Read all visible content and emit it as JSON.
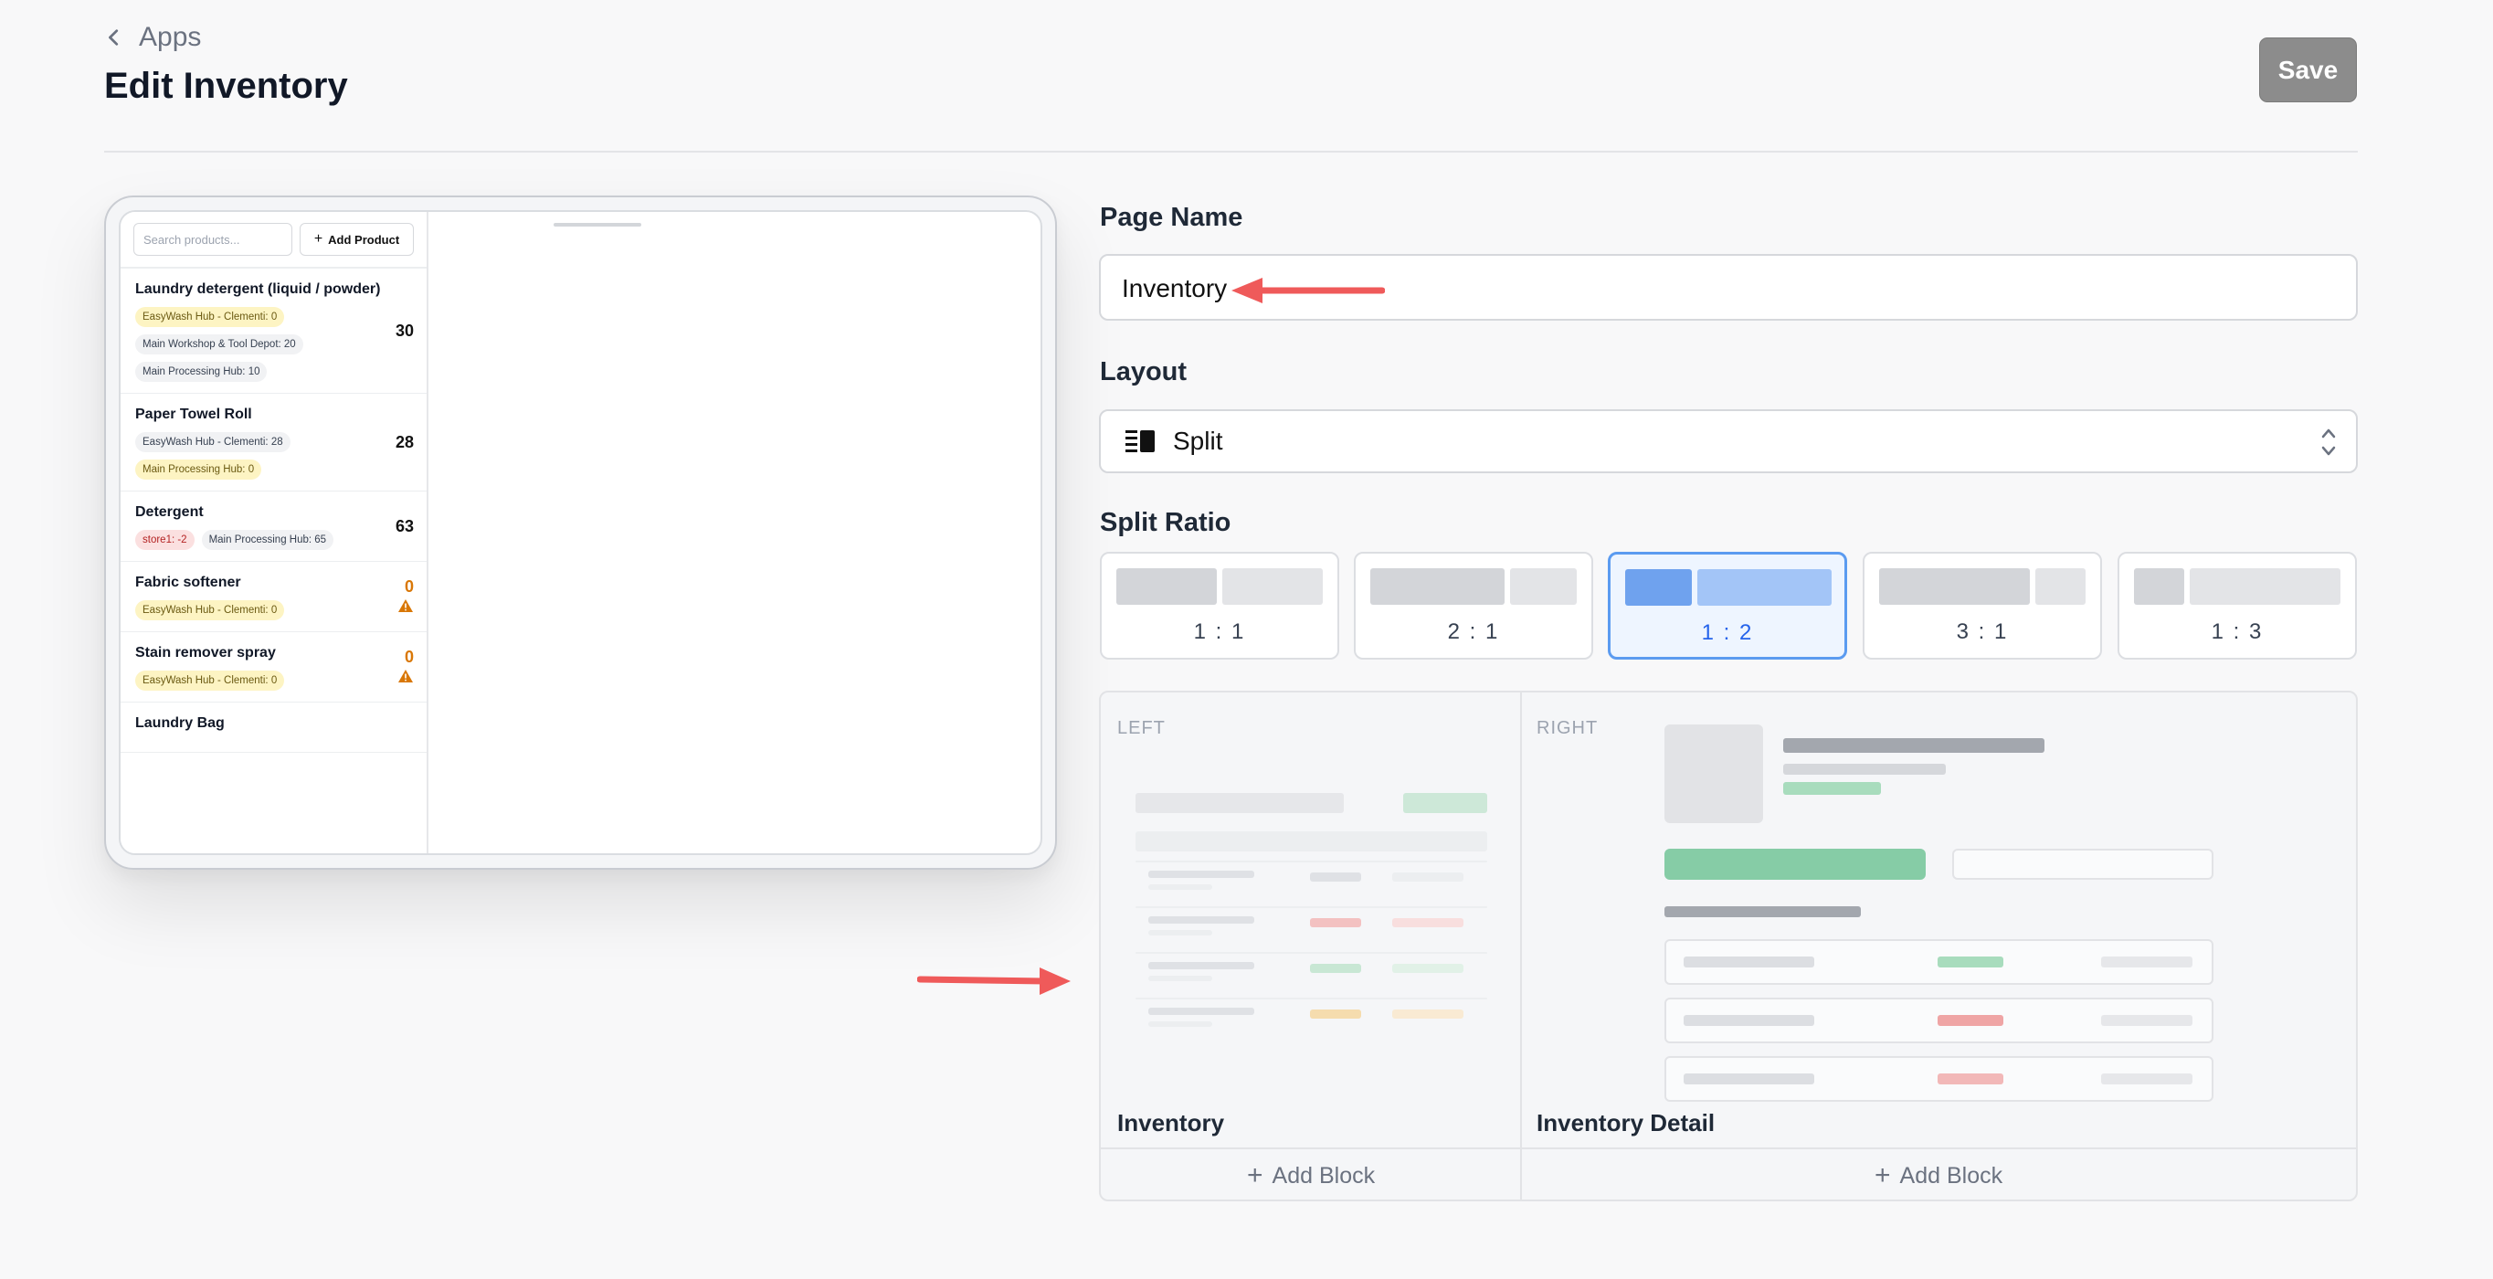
{
  "header": {
    "back_label": "Apps",
    "title": "Edit Inventory",
    "save_label": "Save"
  },
  "preview": {
    "search_placeholder": "Search products...",
    "add_product_label": "Add Product",
    "items": [
      {
        "name": "Laundry detergent (liquid / powder)",
        "qty": "30",
        "chips": [
          {
            "text": "EasyWash Hub - Clementi: 0",
            "tone": "yellow"
          },
          {
            "text": "Main Workshop & Tool Depot: 20",
            "tone": "gray"
          },
          {
            "text": "Main Processing Hub: 10",
            "tone": "gray"
          }
        ]
      },
      {
        "name": "Paper Towel Roll",
        "qty": "28",
        "chips": [
          {
            "text": "EasyWash Hub - Clementi: 28",
            "tone": "gray"
          },
          {
            "text": "Main Processing Hub: 0",
            "tone": "yellow"
          }
        ]
      },
      {
        "name": "Detergent",
        "qty": "63",
        "chips": [
          {
            "text": "store1: -2",
            "tone": "red"
          },
          {
            "text": "Main Processing Hub: 65",
            "tone": "gray"
          }
        ]
      },
      {
        "name": "Fabric softener",
        "qty": "0",
        "chips": [
          {
            "text": "EasyWash Hub - Clementi: 0",
            "tone": "yellow"
          }
        ]
      },
      {
        "name": "Stain remover spray",
        "qty": "0",
        "chips": [
          {
            "text": "EasyWash Hub - Clementi: 0",
            "tone": "yellow"
          }
        ]
      },
      {
        "name": "Laundry Bag",
        "qty": "",
        "chips": []
      }
    ]
  },
  "form": {
    "page_name_label": "Page Name",
    "page_name_value": "Inventory",
    "layout_label": "Layout",
    "layout_value": "Split",
    "split_ratio_label": "Split Ratio",
    "ratios": [
      {
        "label": "1 : 1",
        "selected": false
      },
      {
        "label": "2 : 1",
        "selected": false
      },
      {
        "label": "1 : 2",
        "selected": true
      },
      {
        "label": "3 : 1",
        "selected": false
      },
      {
        "label": "1 : 3",
        "selected": false
      }
    ]
  },
  "canvas": {
    "left_tag": "LEFT",
    "right_tag": "RIGHT",
    "left_name": "Inventory",
    "right_name": "Inventory Detail",
    "add_block_label": "Add Block"
  },
  "colors": {
    "accent": "#2563eb",
    "selected_border": "#5b9bf0",
    "annotation_arrow": "#ef5a5a",
    "warning": "#d97706"
  }
}
